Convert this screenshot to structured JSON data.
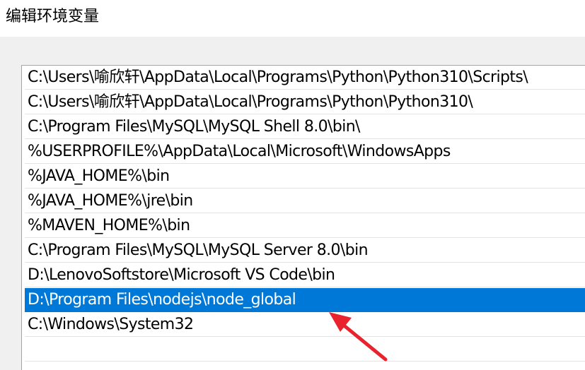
{
  "window": {
    "title": "编辑环境变量"
  },
  "path_list": {
    "entries": [
      "C:\\Users\\喻欣轩\\AppData\\Local\\Programs\\Python\\Python310\\Scripts\\",
      "C:\\Users\\喻欣轩\\AppData\\Local\\Programs\\Python\\Python310\\",
      "C:\\Program Files\\MySQL\\MySQL Shell 8.0\\bin\\",
      "%USERPROFILE%\\AppData\\Local\\Microsoft\\WindowsApps",
      "%JAVA_HOME%\\bin",
      "%JAVA_HOME%\\jre\\bin",
      "%MAVEN_HOME%\\bin",
      "C:\\Program Files\\MySQL\\MySQL Server 8.0\\bin",
      "D:\\LenovoSoftstore\\Microsoft VS Code\\bin",
      "D:\\Program Files\\nodejs\\node_global",
      "C:\\Windows\\System32"
    ],
    "selected_index": 9
  },
  "colors": {
    "selection": "#0078d7",
    "annotation_arrow": "#e8232e"
  }
}
